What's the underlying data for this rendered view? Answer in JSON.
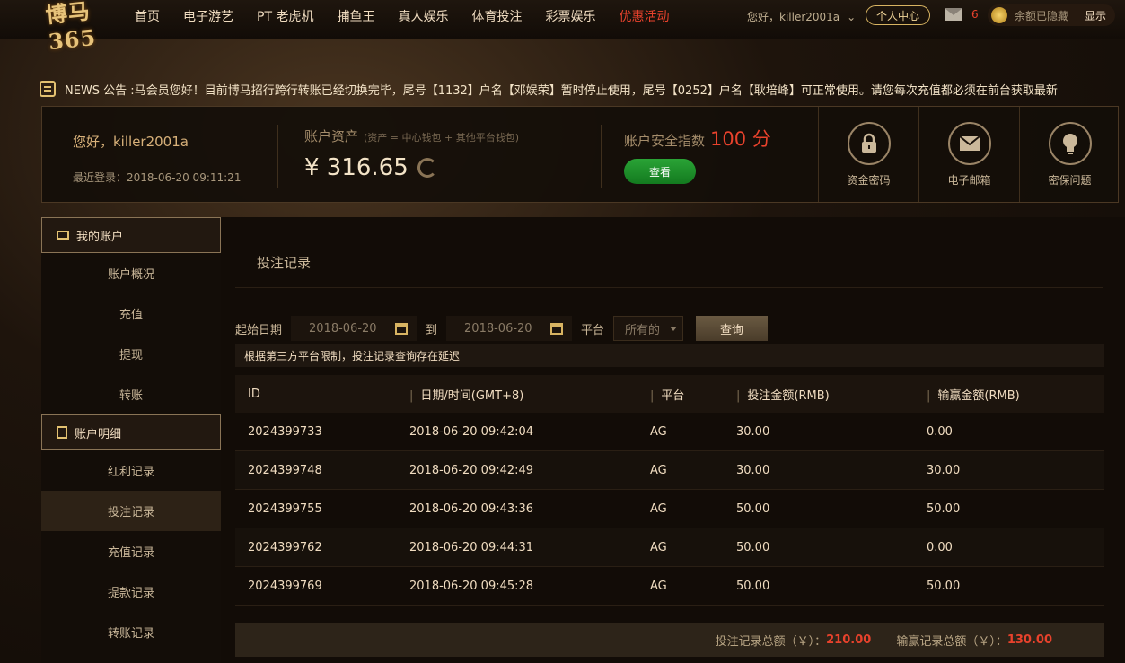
{
  "logo": {
    "text": "博马365"
  },
  "nav": {
    "items": [
      "首页",
      "电子游艺",
      "PT 老虎机",
      "捕鱼王",
      "真人娱乐",
      "体育投注",
      "彩票娱乐",
      "优惠活动"
    ]
  },
  "topbar": {
    "greeting": "您好，killer2001a",
    "personal_center": "个人中心",
    "mail_count": "6",
    "balance_hidden": "余额已隐藏",
    "show_label": "显示"
  },
  "notice": {
    "text": "NEWS 公告 :马会员您好！目前博马招行跨行转账已经切换完毕，尾号【1132】户名【邓娱荣】暂时停止使用，尾号【0252】户名【耿培峰】可正常使用。请您每次充值都必须在前台获取最新"
  },
  "account": {
    "greeting": "您好，killer2001a",
    "last_login": "最近登录：2018-06-20 09:11:21",
    "assets_label": "账户资产",
    "assets_note": "(资产 = 中心钱包 + 其他平台钱包)",
    "assets_amount": "¥ 316.65",
    "security_label": "账户安全指数",
    "security_score": "100 分",
    "view_button": "查看",
    "tiles": [
      "资金密码",
      "电子邮箱",
      "密保问题"
    ]
  },
  "sidebar": {
    "section1": "我的账户",
    "section1_items": [
      "账户概况",
      "充值",
      "提现",
      "转账"
    ],
    "section2": "账户明细",
    "section2_items": [
      "红利记录",
      "投注记录",
      "充值记录",
      "提款记录",
      "转账记录"
    ]
  },
  "main": {
    "title": "投注记录",
    "start_label": "起始日期",
    "start_date": "2018-06-20",
    "to_label": "到",
    "end_date": "2018-06-20",
    "platform_label": "平台",
    "platform_value": "所有的",
    "query_button": "查询",
    "hint": "根据第三方平台限制，投注记录查询存在延迟",
    "columns": [
      "ID",
      "日期/时间(GMT+8)",
      "平台",
      "投注金额(RMB)",
      "输赢金额(RMB)"
    ],
    "rows": [
      [
        "2024399733",
        "2018-06-20 09:42:04",
        "AG",
        "30.00",
        "0.00"
      ],
      [
        "2024399748",
        "2018-06-20 09:42:49",
        "AG",
        "30.00",
        "30.00"
      ],
      [
        "2024399755",
        "2018-06-20 09:43:36",
        "AG",
        "50.00",
        "50.00"
      ],
      [
        "2024399762",
        "2018-06-20 09:44:31",
        "AG",
        "50.00",
        "0.00"
      ],
      [
        "2024399769",
        "2018-06-20 09:45:28",
        "AG",
        "50.00",
        "50.00"
      ]
    ],
    "total_bet_label": "投注记录总额（￥）：",
    "total_bet": "210.00",
    "total_win_label": "输赢记录总额（￥）：",
    "total_win": "130.00"
  }
}
